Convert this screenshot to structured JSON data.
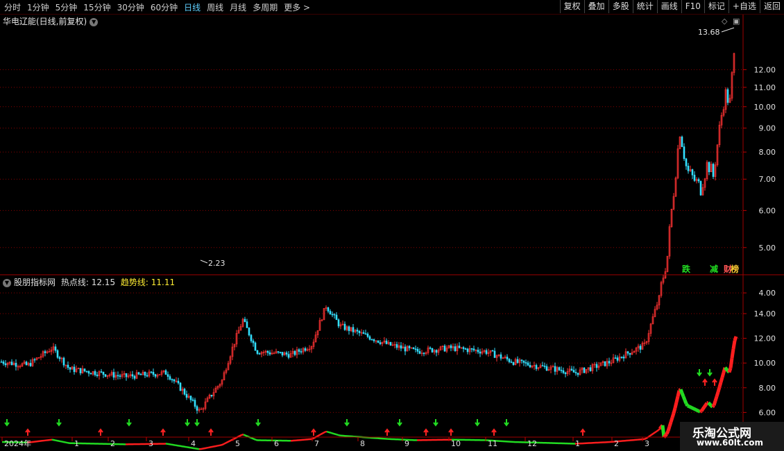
{
  "toolbar": {
    "tabs": [
      {
        "label": "分时",
        "active": false
      },
      {
        "label": "1分钟",
        "active": false
      },
      {
        "label": "5分钟",
        "active": false
      },
      {
        "label": "15分钟",
        "active": false
      },
      {
        "label": "30分钟",
        "active": false
      },
      {
        "label": "60分钟",
        "active": false
      },
      {
        "label": "日线",
        "active": true
      },
      {
        "label": "周线",
        "active": false
      },
      {
        "label": "月线",
        "active": false
      },
      {
        "label": "多周期",
        "active": false
      },
      {
        "label": "更多 >",
        "active": false
      }
    ],
    "actions": [
      "复权",
      "叠加",
      "多股",
      "统计",
      "画线",
      "F10",
      "标记",
      "+自选",
      "返回"
    ]
  },
  "main_chart": {
    "title": "华电辽能(日线,前复权)",
    "high_label": "13.68",
    "low_label": "2.23",
    "yaxis_ticks": [
      "12.00",
      "11.00",
      "10.00",
      "9.00",
      "8.00",
      "7.00",
      "6.00",
      "5.00",
      "4.00"
    ],
    "markers": [
      {
        "text": "跌",
        "color": "#22dd22"
      },
      {
        "text": "减",
        "color": "#22dd22"
      },
      {
        "text": "财",
        "color": "#ff5555"
      },
      {
        "text": "榜",
        "color": "#ffcc33"
      }
    ]
  },
  "indicator": {
    "name": "股朋指标网",
    "hot_label": "热点线:",
    "hot_value": "12.15",
    "trend_label": "趋势线:",
    "trend_value": "11.11",
    "yaxis_ticks": [
      "14.00",
      "12.00",
      "10.00",
      "8.00",
      "6.00",
      "4.00"
    ]
  },
  "xaxis": {
    "labels": [
      "2024年",
      "1",
      "2",
      "3",
      "4",
      "5",
      "6",
      "7",
      "8",
      "9",
      "10",
      "11",
      "12",
      "1",
      "2",
      "3"
    ]
  },
  "colors": {
    "up": "#ff3333",
    "down": "#33e0ff",
    "trend_up": "#ff1e1e",
    "trend_down": "#22dd22",
    "grid": "#8b0000",
    "axis_text": "#e0e0e0"
  },
  "watermark": {
    "title": "乐淘公式网",
    "url": "www.60lt.com"
  }
}
